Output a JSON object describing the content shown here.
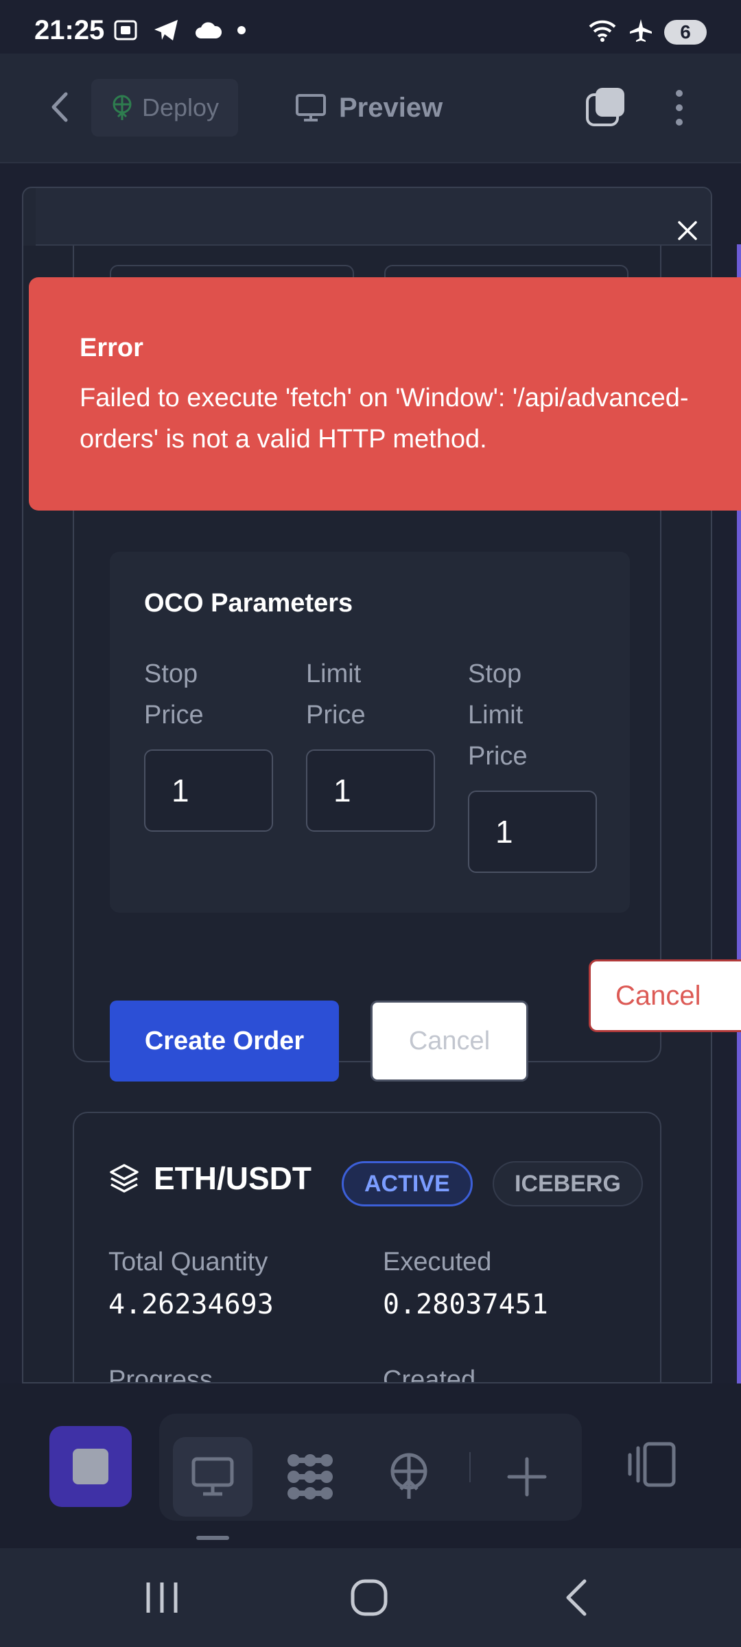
{
  "status_bar": {
    "time": "21:25",
    "battery": "6",
    "icons_left": [
      "screenshot-icon",
      "telegram-icon",
      "cloud-icon",
      "dot-icon"
    ],
    "icons_right": [
      "wifi-icon",
      "airplane-icon",
      "battery-icon"
    ]
  },
  "toolbar": {
    "deploy_label": "Deploy",
    "preview_label": "Preview",
    "icons": [
      "back-icon",
      "deploy-icon",
      "monitor-icon",
      "tabs-icon",
      "more-icon"
    ]
  },
  "toast": {
    "title": "Error",
    "message": "Failed to execute 'fetch' on 'Window': '/api/advanced-\norders' is not a valid HTTP method.",
    "color": "#df514c"
  },
  "oco": {
    "title": "OCO Parameters",
    "fields": [
      {
        "label": "Stop Price",
        "value": "1"
      },
      {
        "label": "Limit Price",
        "value": "1"
      },
      {
        "label": "Stop Limit Price",
        "value": "1"
      }
    ]
  },
  "form_actions": {
    "create_label": "Create Order",
    "cancel_label": "Cancel",
    "accent": "#2c4fd6"
  },
  "order": {
    "pair": "ETH/USDT",
    "status": "ACTIVE",
    "type": "ICEBERG",
    "cancel_label": "Cancel",
    "total_quantity_label": "Total Quantity",
    "total_quantity": "4.26234693",
    "executed_label": "Executed",
    "executed": "0.28037451",
    "progress_label": "Progress",
    "created_label": "Created"
  },
  "dock": {
    "icons": [
      "stop-icon",
      "monitor-icon",
      "nodes-icon",
      "deploy-icon",
      "plus-icon",
      "panel-icon"
    ]
  },
  "nav": {
    "icons": [
      "recents-icon",
      "home-icon",
      "back-icon"
    ]
  }
}
